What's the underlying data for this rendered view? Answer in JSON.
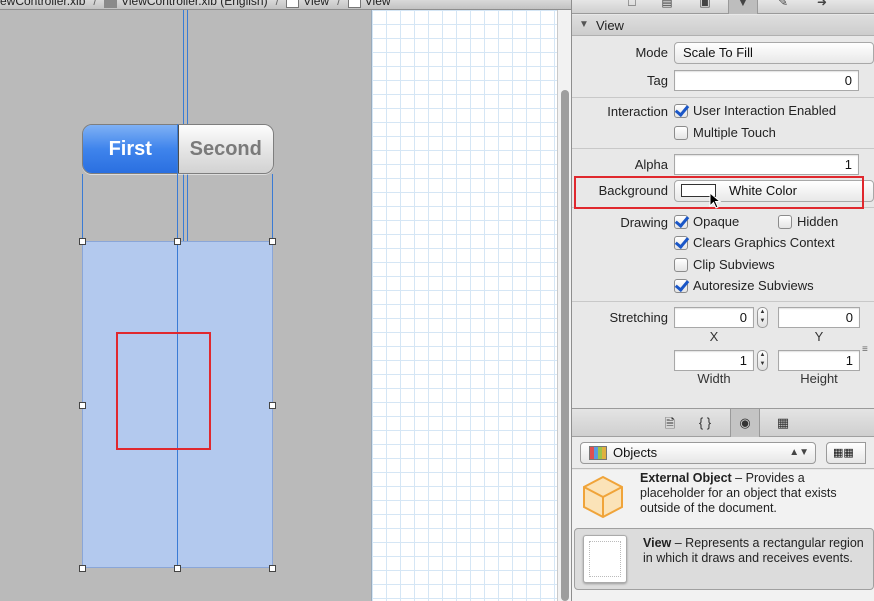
{
  "pathbar": {
    "crumbs": [
      "ewController.xib",
      "ViewController.xib (English)",
      "View",
      "View"
    ]
  },
  "canvas": {
    "segmented": {
      "first": "First",
      "second": "Second",
      "selected_index": 0
    }
  },
  "inspector": {
    "section_title": "View",
    "mode": {
      "label": "Mode",
      "value": "Scale To Fill"
    },
    "tag": {
      "label": "Tag",
      "value": "0"
    },
    "interaction": {
      "label": "Interaction",
      "user_interaction": {
        "label": "User Interaction Enabled",
        "checked": true
      },
      "multiple_touch": {
        "label": "Multiple Touch",
        "checked": false
      }
    },
    "alpha": {
      "label": "Alpha",
      "value": "1"
    },
    "background": {
      "label": "Background",
      "value": "White Color",
      "swatch_color": "#ffffff"
    },
    "drawing": {
      "label": "Drawing",
      "opaque": {
        "label": "Opaque",
        "checked": true
      },
      "hidden": {
        "label": "Hidden",
        "checked": false
      },
      "clears": {
        "label": "Clears Graphics Context",
        "checked": true
      },
      "clip": {
        "label": "Clip Subviews",
        "checked": false
      },
      "autoresize": {
        "label": "Autoresize Subviews",
        "checked": true
      }
    },
    "stretching": {
      "label": "Stretching",
      "x": "0",
      "y": "0",
      "width": "1",
      "height": "1",
      "x_label": "X",
      "y_label": "Y",
      "width_label": "Width",
      "height_label": "Height"
    }
  },
  "library": {
    "tabs": [
      "file-template-icon",
      "code-snippet-icon",
      "object-library-icon",
      "media-library-icon"
    ],
    "filter": {
      "selected": "Objects"
    },
    "items": [
      {
        "title": "External Object",
        "desc": " – Provides a placeholder for an object that exists outside of the document."
      },
      {
        "title": "View",
        "desc": " – Represents a rectangular region in which it draws and receives events."
      }
    ]
  },
  "colors": {
    "accent_blue": "#3f84ec",
    "highlight_red": "#e0282e",
    "view_fill": "#b3c9ee"
  }
}
